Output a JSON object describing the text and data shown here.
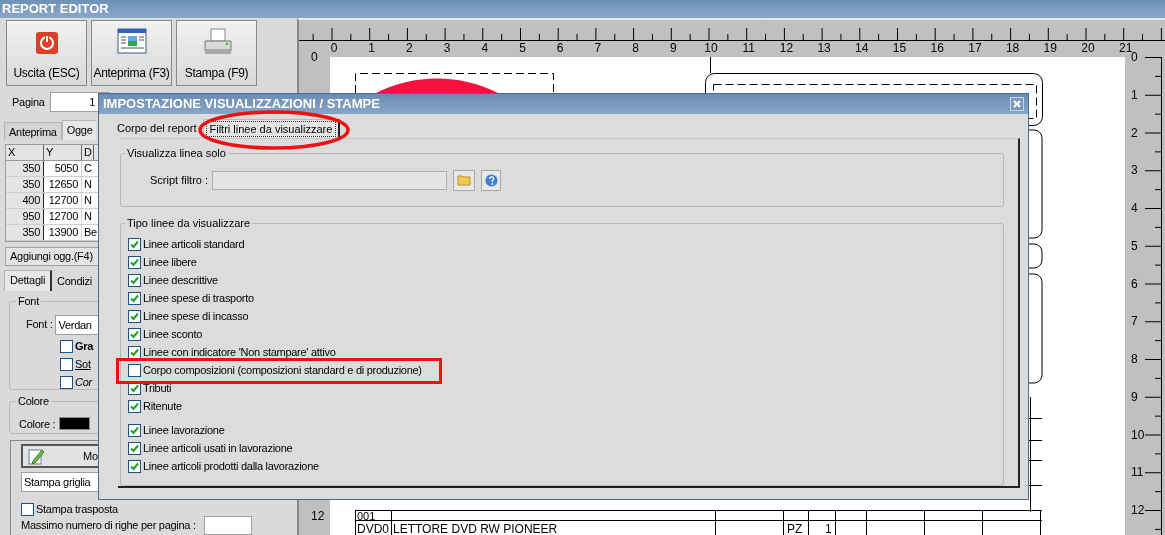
{
  "window": {
    "title": "REPORT EDITOR"
  },
  "toolbar": [
    {
      "label": "Uscita (ESC)",
      "kind": "exit"
    },
    {
      "label": "Anteprima (F3)",
      "kind": "preview"
    },
    {
      "label": "Stampa (F9)",
      "kind": "print"
    }
  ],
  "page_field": {
    "label": "Pagina",
    "value": "1"
  },
  "top_tabs": [
    {
      "label": "Anteprima",
      "selected": false
    },
    {
      "label": "Ogge",
      "selected": true
    }
  ],
  "objects_table": {
    "columns": [
      "X",
      "Y",
      "D"
    ],
    "rows": [
      [
        "350",
        "5050",
        "C"
      ],
      [
        "350",
        "12650",
        "N"
      ],
      [
        "400",
        "12700",
        "N"
      ],
      [
        "950",
        "12700",
        "N"
      ],
      [
        "350",
        "13900",
        "Be"
      ]
    ]
  },
  "add_button": "Aggiungi ogg.(F4)",
  "detail_tabs": [
    {
      "label": "Dettagli",
      "selected": true
    },
    {
      "label": "Condizi",
      "selected": false
    }
  ],
  "font_group": {
    "title": "Font",
    "label": "Font :",
    "value": "Verdan",
    "styles": [
      {
        "label": "Gra",
        "kind": "bold",
        "checked": false
      },
      {
        "label": "Sot",
        "kind": "underline",
        "checked": false
      },
      {
        "label": "Cor",
        "kind": "italic",
        "checked": false
      }
    ]
  },
  "color_group": {
    "title": "Colore",
    "label": "Colore :",
    "color": "#000000"
  },
  "edit_button": "Mo",
  "grid_select": "Stampa griglia",
  "transpose": {
    "label": "Stampa trasposta",
    "checked": false
  },
  "max_rows": {
    "label": "Massimo numero di righe per pagina :"
  },
  "top_ruler": [
    "0",
    "1",
    "2",
    "3",
    "4",
    "5",
    "6",
    "7",
    "8",
    "9",
    "10",
    "11",
    "12",
    "13",
    "14",
    "15",
    "16",
    "17",
    "18",
    "19",
    "20",
    "21"
  ],
  "left_ruler": [
    "0",
    "12"
  ],
  "right_ruler": [
    "0",
    "1",
    "2",
    "3",
    "4",
    "5",
    "6",
    "7",
    "8",
    "9",
    "10",
    "11",
    "12"
  ],
  "page_rows": [
    [
      "001"
    ],
    [
      "DVD0",
      "LETTORE DVD RW PIONEER",
      "PZ",
      "1"
    ]
  ],
  "dialog": {
    "title": "IMPOSTAZIONE VISUALIZZAZIONI / STAMPE",
    "tabs": [
      {
        "label": "Corpo del report",
        "selected": false
      },
      {
        "label": "Filtri linee da visualizzare",
        "selected": true
      }
    ],
    "filter_group": {
      "title": "Visualizza linea solo",
      "label": "Script filtro :"
    },
    "line_types": {
      "title": "Tipo linee da visualizzare",
      "groups": [
        {
          "items": [
            {
              "label": "Linee articoli standard",
              "checked": true
            },
            {
              "label": "Linee libere",
              "checked": true
            },
            {
              "label": "Linee descrittive",
              "checked": true
            },
            {
              "label": "Linee spese di trasporto",
              "checked": true
            },
            {
              "label": "Linee spese di incasso",
              "checked": true
            },
            {
              "label": "Linee sconto",
              "checked": true
            },
            {
              "label": "Linee con indicatore 'Non stampare' attivo",
              "checked": true
            },
            {
              "label": "Corpo composizioni (composizioni standard e di produzione)",
              "checked": false
            },
            {
              "label": "Tributi",
              "checked": true
            },
            {
              "label": "Ritenute",
              "checked": true
            }
          ]
        },
        {
          "items": [
            {
              "label": "Linee lavorazione",
              "checked": true
            },
            {
              "label": "Linee articoli usati in lavorazione",
              "checked": true
            },
            {
              "label": "Linee articoli prodotti dalla lavorazione",
              "checked": true
            }
          ]
        }
      ]
    }
  },
  "annotations": [
    {
      "kind": "ellipse"
    },
    {
      "kind": "rectangle"
    }
  ]
}
